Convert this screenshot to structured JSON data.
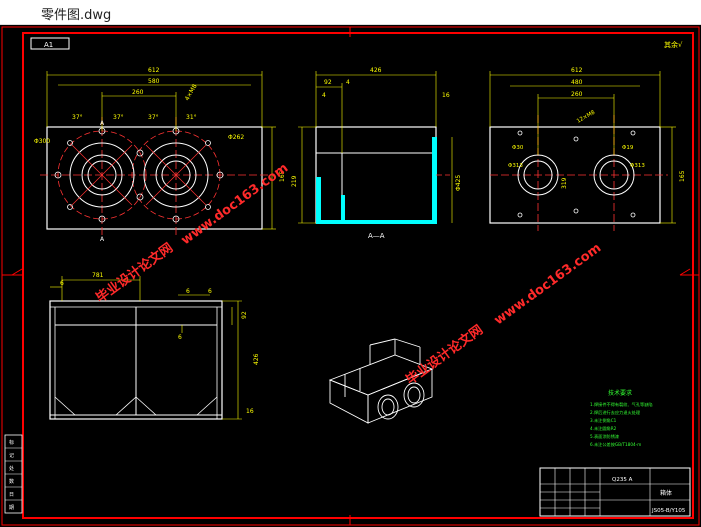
{
  "window": {
    "file_name": "零件图.dwg"
  },
  "frame": {
    "zone_label": "A1",
    "roughness_mark": "其余√"
  },
  "front_view": {
    "dims": {
      "total_width": "612",
      "inner_width": "580",
      "center_dist": "260",
      "height": "165",
      "left_bore": "Φ300",
      "right_bore": "Φ262",
      "angle_1": "37°",
      "angle_2": "37°",
      "angle_3": "37°",
      "angle_4": "31°",
      "hole_spec": "4×M8"
    },
    "section_mark": "A"
  },
  "section_view": {
    "dims": {
      "width": "426",
      "d1": "92",
      "d2": "4",
      "d3": "4",
      "d4": "16",
      "height": "219",
      "bore": "Φ425"
    },
    "label": "A—A"
  },
  "side_view": {
    "dims": {
      "total_width": "612",
      "inner_width": "480",
      "center_dist": "260",
      "height": "165",
      "side_h": "319",
      "bore_l": "Φ313",
      "bore_r": "Φ313",
      "pcd_l": "Φ30",
      "pcd_r": "Φ19",
      "hole_spec": "12×M8"
    }
  },
  "bottom_view": {
    "dims": {
      "width": "781",
      "d1": "6",
      "d2": "6",
      "d3": "6",
      "d4": "92",
      "d5": "6",
      "height": "426",
      "base": "16"
    }
  },
  "tech_notes": {
    "title": "技术要求",
    "lines": [
      "1.焊接件不得有裂纹、气孔等缺陷",
      "2.焊后进行去应力退火处理",
      "3.未注倒角C1",
      "4.未注圆角R2",
      "5.表面涂防锈漆",
      "6.未注公差按GB/T1804-m"
    ]
  },
  "title_block": {
    "material": "Q235 A",
    "part_name": "箱体",
    "drawing_no": "JS05-B/Y105"
  },
  "left_strip": [
    "标",
    "记",
    "处",
    "数",
    "日",
    "期"
  ],
  "watermarks": {
    "site": "www.doc163.com",
    "name": "毕业设计论文网"
  },
  "colors": {
    "frame": "#ff0000",
    "dimension": "#ffff00",
    "outline": "#ffffff",
    "center": "#ff3333",
    "section": "#00ffff",
    "notes": "#33ff33"
  }
}
